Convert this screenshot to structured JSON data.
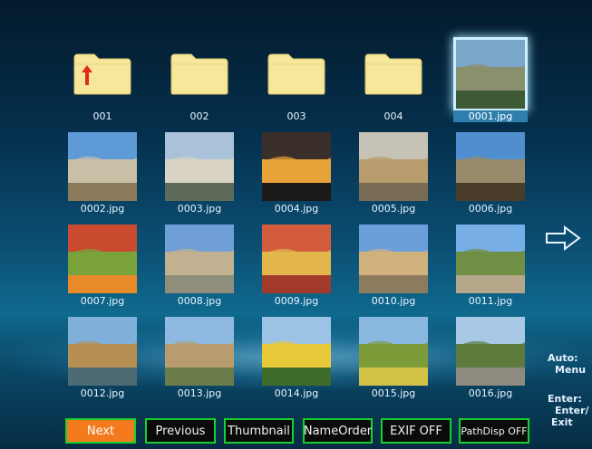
{
  "items": [
    {
      "label": "001",
      "type": "folder",
      "up": true
    },
    {
      "label": "002",
      "type": "folder"
    },
    {
      "label": "003",
      "type": "folder"
    },
    {
      "label": "004",
      "type": "folder"
    },
    {
      "label": "0001.jpg",
      "type": "photo",
      "selected": true,
      "c1": "#7aa6c9",
      "c2": "#8a8f6e",
      "c3": "#3e5a36"
    },
    {
      "label": "0002.jpg",
      "type": "photo",
      "c1": "#5d9ad6",
      "c2": "#c9bfa6",
      "c3": "#8a7a5a"
    },
    {
      "label": "0003.jpg",
      "type": "photo",
      "c1": "#a9c2d9",
      "c2": "#d8d3c2",
      "c3": "#5e6a5a"
    },
    {
      "label": "0004.jpg",
      "type": "photo",
      "c1": "#3a2e2b",
      "c2": "#e7a23a",
      "c3": "#1c1a18"
    },
    {
      "label": "0005.jpg",
      "type": "photo",
      "c1": "#c7c2b6",
      "c2": "#b99c6e",
      "c3": "#7a6b55"
    },
    {
      "label": "0006.jpg",
      "type": "photo",
      "c1": "#4f8ecf",
      "c2": "#9a8a6c",
      "c3": "#4b3d2c"
    },
    {
      "label": "0007.jpg",
      "type": "photo",
      "c1": "#c94a2f",
      "c2": "#7aa23b",
      "c3": "#e88a2a"
    },
    {
      "label": "0008.jpg",
      "type": "photo",
      "c1": "#6f9fd6",
      "c2": "#c2b190",
      "c3": "#8e8e7a"
    },
    {
      "label": "0009.jpg",
      "type": "photo",
      "c1": "#d35c3d",
      "c2": "#e2b64b",
      "c3": "#a23a2b"
    },
    {
      "label": "0010.jpg",
      "type": "photo",
      "c1": "#6a9fdc",
      "c2": "#d1b27d",
      "c3": "#8d7b5e"
    },
    {
      "label": "0011.jpg",
      "type": "photo",
      "c1": "#78aee6",
      "c2": "#6e8f45",
      "c3": "#b5a88a"
    },
    {
      "label": "0012.jpg",
      "type": "photo",
      "c1": "#7fb0d9",
      "c2": "#b88f52",
      "c3": "#4e6a73"
    },
    {
      "label": "0013.jpg",
      "type": "photo",
      "c1": "#8fb9e0",
      "c2": "#b89c6e",
      "c3": "#6b7d4a"
    },
    {
      "label": "0014.jpg",
      "type": "photo",
      "c1": "#9cc3e3",
      "c2": "#e8c93a",
      "c3": "#3f6b2a"
    },
    {
      "label": "0015.jpg",
      "type": "photo",
      "c1": "#8ab7df",
      "c2": "#7e9b3a",
      "c3": "#d2c347"
    },
    {
      "label": "0016.jpg",
      "type": "photo",
      "c1": "#a8c9e6",
      "c2": "#5b7a3c",
      "c3": "#8f8a80"
    }
  ],
  "side": {
    "auto_title": "Auto:",
    "auto_value": "Menu",
    "enter_title": "Enter:",
    "enter_value1": "Enter/",
    "enter_value2": "Exit"
  },
  "buttons": [
    {
      "label": "Next",
      "active": true
    },
    {
      "label": "Previous"
    },
    {
      "label": "Thumbnail"
    },
    {
      "label": "NameOrder"
    },
    {
      "label": "EXIF OFF"
    },
    {
      "label": "PathDisp OFF"
    }
  ],
  "icons": {
    "next_page": "arrow-right-icon",
    "folder": "folder-icon",
    "parent": "up-arrow-icon"
  }
}
